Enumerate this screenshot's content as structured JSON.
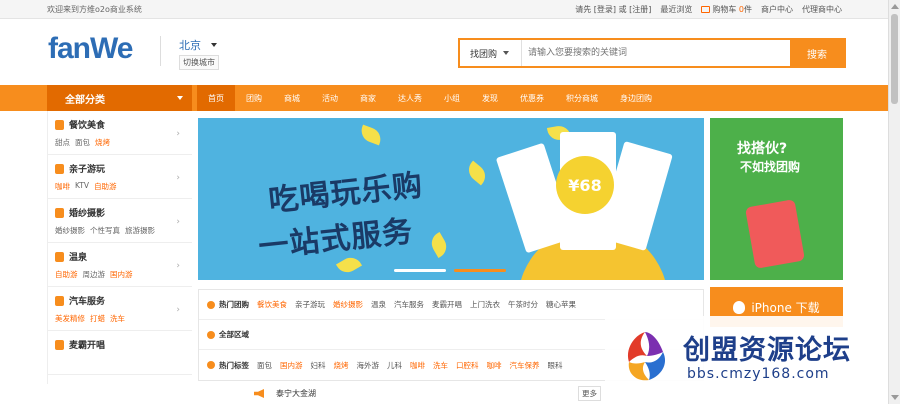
{
  "topbar": {
    "welcome": "欢迎来到方维o2o商业系统",
    "login_prefix": "请先",
    "login": "[登录]",
    "or": "或",
    "register": "[注册]",
    "recent": "最近浏览",
    "cart_label": "购物车",
    "cart_count": "0",
    "cart_unit": "件",
    "merchant_center": "商户中心",
    "agent_center": "代理商中心"
  },
  "header": {
    "logo": "fanWe",
    "city": "北京",
    "switch_city": "切换城市",
    "search_type": "找团购",
    "search_placeholder": "请输入您要搜索的关键词",
    "search_button": "搜索"
  },
  "nav": {
    "all_categories": "全部分类",
    "items": [
      "首页",
      "团购",
      "商城",
      "活动",
      "商家",
      "达人秀",
      "小组",
      "发现",
      "优惠券",
      "积分商城",
      "身边团购"
    ]
  },
  "sidebar": {
    "categories": [
      {
        "title": "餐饮美食",
        "subs": [
          {
            "t": "甜点",
            "hot": false
          },
          {
            "t": "面包",
            "hot": false
          },
          {
            "t": "烧烤",
            "hot": true
          }
        ]
      },
      {
        "title": "亲子游玩",
        "subs": [
          {
            "t": "咖啡",
            "hot": true
          },
          {
            "t": "KTV",
            "hot": false
          },
          {
            "t": "自助游",
            "hot": true
          }
        ]
      },
      {
        "title": "婚纱摄影",
        "subs": [
          {
            "t": "婚纱摄影",
            "hot": false
          },
          {
            "t": "个性写真",
            "hot": false
          },
          {
            "t": "旅游摄影",
            "hot": false
          }
        ]
      },
      {
        "title": "温泉",
        "subs": [
          {
            "t": "自助游",
            "hot": true
          },
          {
            "t": "周边游",
            "hot": false
          },
          {
            "t": "国内游",
            "hot": true
          }
        ]
      },
      {
        "title": "汽车服务",
        "subs": [
          {
            "t": "美发精修",
            "hot": true
          },
          {
            "t": "打蜡",
            "hot": true
          },
          {
            "t": "洗车",
            "hot": true
          }
        ]
      },
      {
        "title": "麦霸开唱",
        "subs": []
      }
    ]
  },
  "banner": {
    "line1": "吃喝玩乐购",
    "line2": "一站式服务",
    "price": "¥68"
  },
  "ad": {
    "line1": "找搭伙?",
    "line2": "不如找团购",
    "iphone": "iPhone 下载"
  },
  "filters": {
    "hot_label": "热门团购",
    "hot_tags": [
      {
        "t": "餐饮美食",
        "hot": true
      },
      {
        "t": "亲子游玩",
        "hot": false
      },
      {
        "t": "婚纱摄影",
        "hot": true
      },
      {
        "t": "温泉",
        "hot": false
      },
      {
        "t": "汽车服务",
        "hot": false
      },
      {
        "t": "麦霸开唱",
        "hot": false
      },
      {
        "t": "上门洗衣",
        "hot": false
      },
      {
        "t": "午茶时分",
        "hot": false
      },
      {
        "t": "糖心苹果",
        "hot": false
      }
    ],
    "area_label": "全部区域",
    "tags_label": "热门标签",
    "tags": [
      {
        "t": "面包",
        "hot": false
      },
      {
        "t": "国内游",
        "hot": true
      },
      {
        "t": "妇科",
        "hot": false
      },
      {
        "t": "烧烤",
        "hot": true
      },
      {
        "t": "海外游",
        "hot": false
      },
      {
        "t": "儿科",
        "hot": false
      },
      {
        "t": "咖啡",
        "hot": true
      },
      {
        "t": "洗车",
        "hot": true
      },
      {
        "t": "口腔科",
        "hot": true
      },
      {
        "t": "咖啡",
        "hot": true
      },
      {
        "t": "汽车保养",
        "hot": true
      },
      {
        "t": "眼科",
        "hot": false
      }
    ]
  },
  "notice": {
    "text": "泰宁大金湖",
    "more": "更多"
  },
  "watermark": {
    "title": "创盟资源论坛",
    "url": "bbs.cmzy168.com"
  },
  "colors": {
    "accent": "#f78d1d",
    "accent_dark": "#e26a00",
    "brand_blue": "#2d6db5",
    "banner_bg": "#4fb3e0"
  }
}
